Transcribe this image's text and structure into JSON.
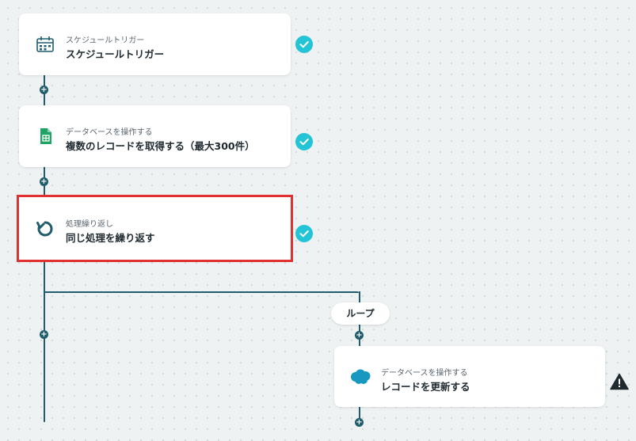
{
  "colors": {
    "connector": "#1f5c6c",
    "check": "#23c4d6",
    "selection": "#e03030",
    "sheets_green": "#1fa463",
    "salesforce_blue": "#1798c1"
  },
  "steps": [
    {
      "subtitle": "スケジュールトリガー",
      "title": "スケジュールトリガー",
      "icon": "calendar-clock-icon",
      "status": "check-icon"
    },
    {
      "subtitle": "データベースを操作する",
      "title": "複数のレコードを取得する（最大300件）",
      "icon": "google-sheets-icon",
      "status": "check-icon"
    },
    {
      "subtitle": "処理繰り返し",
      "title": "同じ処理を繰り返す",
      "icon": "loop-arrow-icon",
      "status": "check-icon",
      "selected": true
    }
  ],
  "loop": {
    "label": "ループ",
    "step": {
      "subtitle": "データベースを操作する",
      "title": "レコードを更新する",
      "icon": "salesforce-cloud-icon",
      "status": "warning-icon"
    }
  }
}
